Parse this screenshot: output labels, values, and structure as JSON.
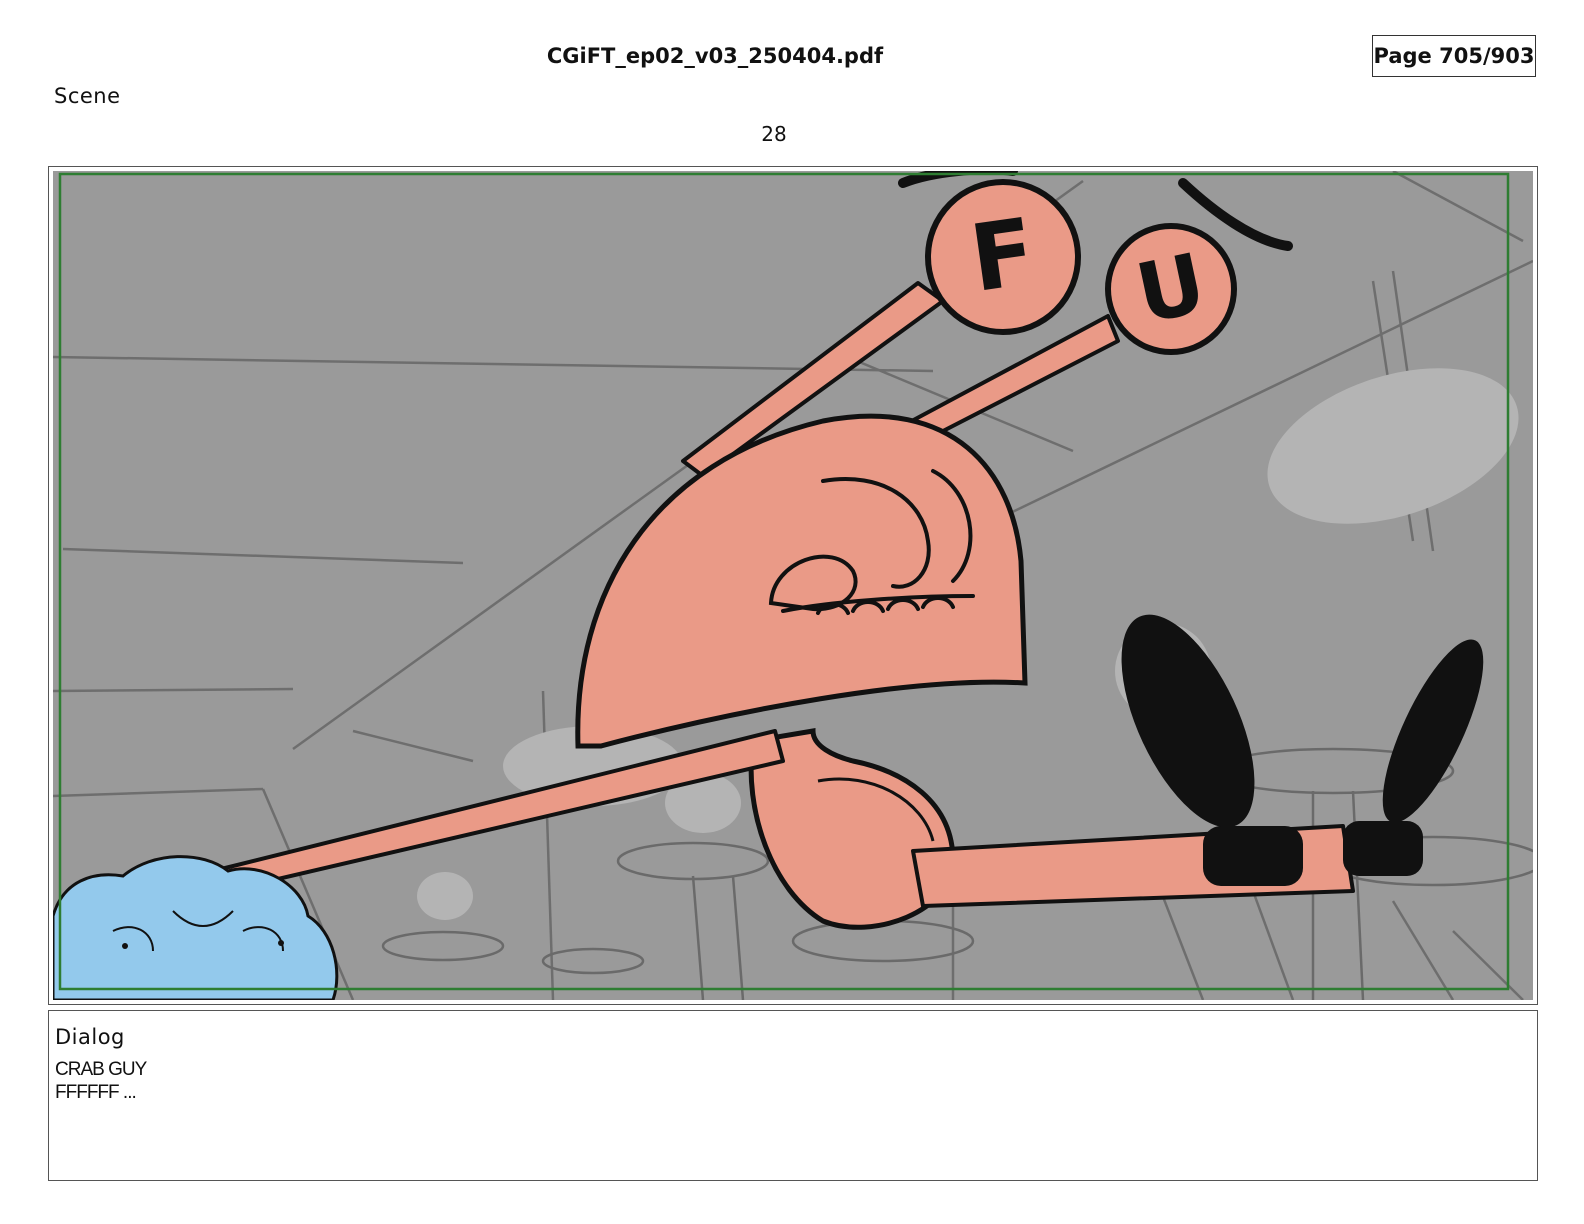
{
  "header": {
    "file_name": "CGiFT_ep02_v03_250404.pdf",
    "page_indicator": "Page 705/903"
  },
  "scene": {
    "label": "Scene",
    "number": "28"
  },
  "panel": {
    "colors": {
      "background": "#9a9a9a",
      "crab_body": "#ea9a87",
      "blue_creature": "#93c9ec",
      "safe_frame": "#2e7d32",
      "ink": "#111111"
    },
    "eye_letters": [
      "F",
      "U"
    ]
  },
  "dialog": {
    "label": "Dialog",
    "lines": [
      "CRAB GUY",
      "FFFFFF ..."
    ]
  }
}
